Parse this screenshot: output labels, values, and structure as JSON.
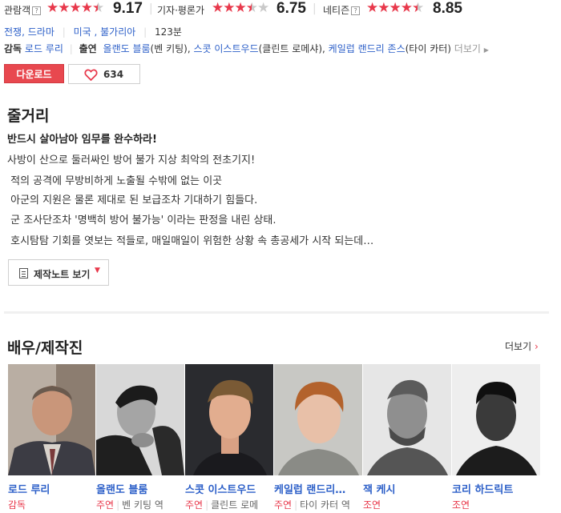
{
  "ratings": [
    {
      "label": "관람객",
      "score": "9.17",
      "stars": 4.5,
      "help": "?"
    },
    {
      "label": "기자·평론가",
      "score": "6.75",
      "stars": 3.5
    },
    {
      "label": "네티즌",
      "score": "8.85",
      "stars": 4.5,
      "help": "?"
    }
  ],
  "info": {
    "genres": [
      "전쟁",
      "드라마"
    ],
    "countries": [
      "미국",
      "불가리아"
    ],
    "runtime": "123분",
    "director_label": "감독",
    "director": "로드 루리",
    "cast_label": "출연",
    "cast": [
      {
        "name": "올랜도 블룸",
        "role": "(벤 키팅)"
      },
      {
        "name": "스콧 이스트우드",
        "role": "(클린트 로메샤)"
      },
      {
        "name": "케일럽 랜드리 존스",
        "role": "(타이 카터)"
      }
    ],
    "more": "더보기"
  },
  "actions": {
    "download": "다운로드",
    "likes": "634"
  },
  "synopsis": {
    "title": "줄거리",
    "headline": "반드시 살아남아 임무를 완수하라!",
    "lines": [
      "사방이 산으로 둘러싸인 방어 불가 지상 최악의 전초기지!",
      " 적의 공격에 무방비하게 노출될 수밖에 없는 이곳",
      " 아군의 지원은 물론 제대로 된 보급조차 기대하기 힘들다.",
      " 군 조사단조차 '명백히 방어 불가능' 이라는 판정을 내린 상태.",
      " 호시탐탐 기회를 엿보는 적들로, 매일매일이 위험한 상황 속 총공세가 시작 되는데…"
    ],
    "note_button": "제작노트 보기"
  },
  "crew": {
    "title": "배우/제작진",
    "more": "더보기",
    "people": [
      {
        "name": "로드 루리",
        "role": "감독",
        "character": ""
      },
      {
        "name": "올랜도 블룸",
        "role": "주연",
        "character": "벤 키팅 역"
      },
      {
        "name": "스콧 이스트우드",
        "role": "주연",
        "character": "클린트 로메"
      },
      {
        "name": "케일럽 랜드리…",
        "role": "주연",
        "character": "타이 카터 역"
      },
      {
        "name": "잭 케시",
        "role": "조연",
        "character": ""
      },
      {
        "name": "코리 하드릭트",
        "role": "조연",
        "character": ""
      }
    ]
  },
  "colors": {
    "accent": "#e8384b",
    "link": "#2c5fc8",
    "download_bg": "#e8484f"
  }
}
